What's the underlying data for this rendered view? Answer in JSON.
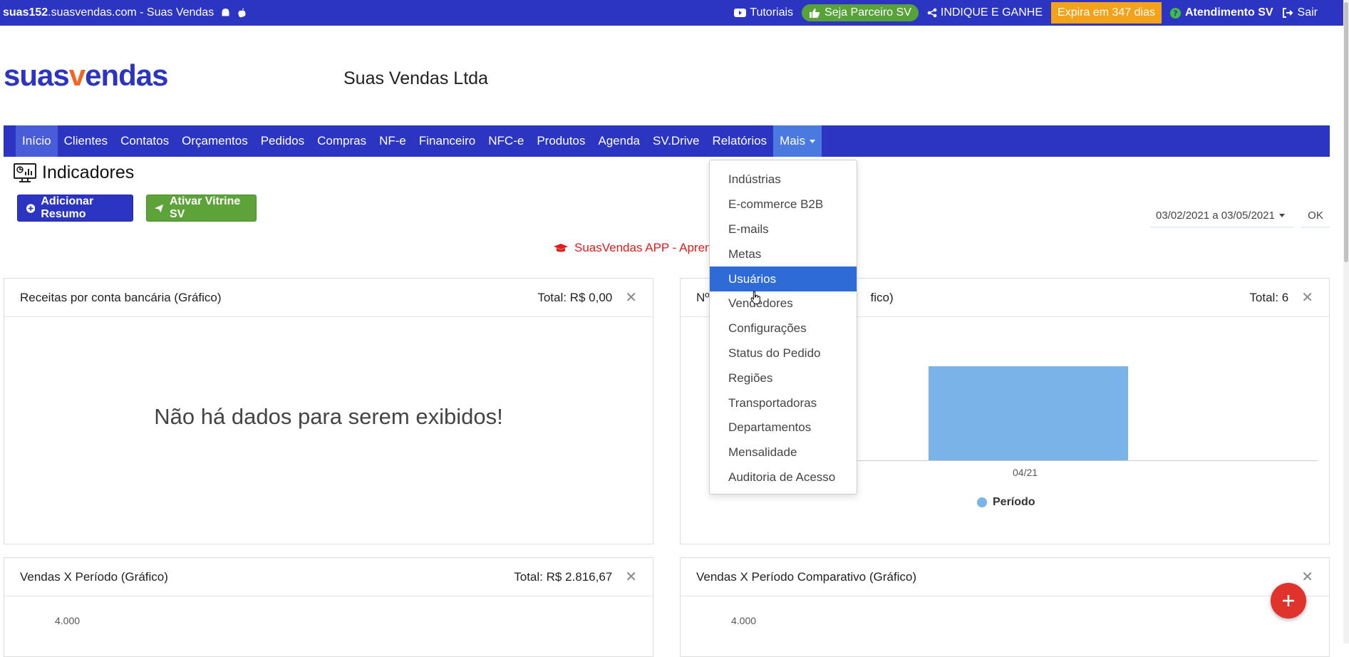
{
  "topbar": {
    "domain_bold": "suas152",
    "domain_rest": ".suasvendas.com - Suas Vendas",
    "tutoriais": "Tutoriais",
    "parceiro": "Seja Parceiro SV",
    "indique": "INDIQUE E GANHE",
    "expira": "Expira em 347 dias",
    "atendimento": "Atendimento SV",
    "sair": "Sair"
  },
  "logo": {
    "part1": "suas",
    "part2": "v",
    "part3": "endas"
  },
  "company": "Suas Vendas Ltda",
  "nav": {
    "items": [
      "Início",
      "Clientes",
      "Contatos",
      "Orçamentos",
      "Pedidos",
      "Compras",
      "NF-e",
      "Financeiro",
      "NFC-e",
      "Produtos",
      "Agenda",
      "SV.Drive",
      "Relatórios"
    ],
    "mais": "Mais"
  },
  "page": {
    "title": "Indicadores",
    "add_resumo": "Adicionar Resumo",
    "ativar_vitrine": "Ativar Vitrine SV",
    "daterange": "03/02/2021 a 03/05/2021",
    "ok": "OK",
    "promo": "SuasVendas APP - Aprend"
  },
  "cards": {
    "receitas": {
      "title": "Receitas por conta bancária (Gráfico)",
      "total": "Total: R$ 0,00",
      "empty": "Não há dados para serem exibidos!"
    },
    "pedidos": {
      "title_start": "Nº",
      "title_end": "fico)",
      "total": "Total: 6"
    },
    "vendas": {
      "title": "Vendas X Período (Gráfico)",
      "total": "Total: R$ 2.816,67",
      "ytick": "4.000"
    },
    "comparativo": {
      "title": "Vendas X Período Comparativo (Gráfico)",
      "ytick": "4.000"
    }
  },
  "chart_data": {
    "type": "bar",
    "categories": [
      "04/21"
    ],
    "series": [
      {
        "name": "Período",
        "values": [
          6
        ]
      }
    ],
    "color": "#7ab3e8"
  },
  "dropdown": {
    "items": [
      "Indústrias",
      "E-commerce B2B",
      "E-mails",
      "Metas",
      "Usuários",
      "Vendedores",
      "Configurações",
      "Status do Pedido",
      "Regiões",
      "Transportadoras",
      "Departamentos",
      "Mensalidade",
      "Auditoria de Acesso"
    ],
    "highlighted": "Usuários"
  },
  "colors": {
    "brand": "#2b35c1",
    "accent_orange": "#f26522",
    "green": "#5ea33a",
    "highlight": "#2f6bd6",
    "fab": "#e0332c"
  },
  "icons": {
    "fab": "plus-icon",
    "title": "monitor-chart-icon"
  }
}
